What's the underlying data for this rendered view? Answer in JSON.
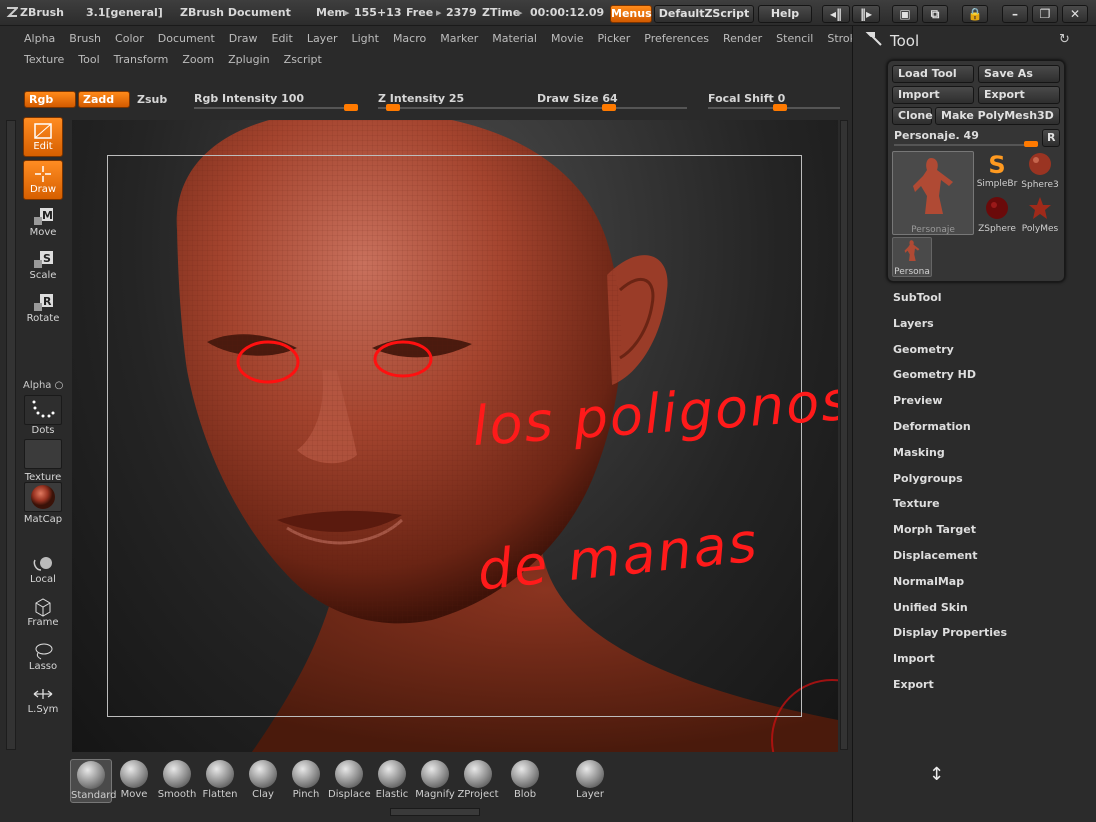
{
  "titlebar": {
    "app": "ZBrush",
    "version": "3.1[general]",
    "document": "ZBrush Document",
    "mem_label": "Mem",
    "mem_value": "155+13",
    "free_label": "Free",
    "free_value": "2379",
    "ztime_label": "ZTime",
    "ztime_value": "00:00:12.09",
    "menus_button": "Menus",
    "script_button": "DefaultZScript",
    "help_button": "Help"
  },
  "menus": {
    "row1": [
      "Alpha",
      "Brush",
      "Color",
      "Document",
      "Draw",
      "Edit",
      "Layer",
      "Light",
      "Macro",
      "Marker",
      "Material",
      "Movie",
      "Picker",
      "Preferences",
      "Render",
      "Stencil",
      "Stroke"
    ],
    "row2": [
      "Texture",
      "Tool",
      "Transform",
      "Zoom",
      "Zplugin",
      "Zscript"
    ]
  },
  "brushbar": {
    "rgb": "Rgb",
    "zadd": "Zadd",
    "zsub": "Zsub",
    "rgb_intensity_label": "Rgb Intensity",
    "rgb_intensity_value": "100",
    "rgb_intensity_fraction": 1.0,
    "z_intensity_label": "Z Intensity",
    "z_intensity_value": "25",
    "z_intensity_fraction": 0.25,
    "draw_size_label": "Draw Size",
    "draw_size_value": "64",
    "draw_size_fraction": 0.06,
    "focal_shift_label": "Focal Shift",
    "focal_shift_value": "0",
    "focal_shift_fraction": 0.0
  },
  "shelf": {
    "edit": "Edit",
    "draw": "Draw",
    "move": "Move",
    "scale": "Scale",
    "rotate": "Rotate",
    "alpha": "Alpha",
    "dots": "Dots",
    "texture": "Texture",
    "matcap": "MatCap",
    "local": "Local",
    "frame": "Frame",
    "lasso": "Lasso",
    "lsym": "L.Sym"
  },
  "brushes": [
    "Standard",
    "Move",
    "Smooth",
    "Flatten",
    "Clay",
    "Pinch",
    "Displace",
    "Elastic",
    "Magnify",
    "ZProject",
    "Blob",
    "Layer"
  ],
  "tool_panel": {
    "title": "Tool",
    "load_tool": "Load Tool",
    "save_as": "Save As",
    "import": "Import",
    "export": "Export",
    "clone": "Clone",
    "make_polymesh": "Make PolyMesh3D",
    "current_tool": "Personaje. 49",
    "r_button": "R",
    "thumbs": [
      "Personaje",
      "SimpleBr",
      "Sphere3",
      "ZSphere",
      "PolyMes",
      "Persona"
    ],
    "sections": [
      "SubTool",
      "Layers",
      "Geometry",
      "Geometry HD",
      "Preview",
      "Deformation",
      "Masking",
      "Polygroups",
      "Texture",
      "Morph Target",
      "Displacement",
      "NormalMap",
      "Unified Skin",
      "Display Properties",
      "Import",
      "Export"
    ]
  },
  "annotation": {
    "line1": "los poligonos",
    "line2": "de manas"
  }
}
